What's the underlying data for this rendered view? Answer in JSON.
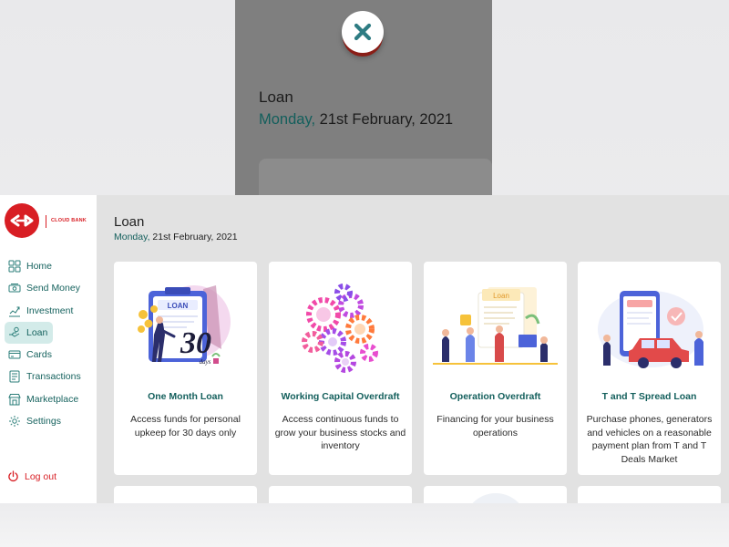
{
  "overlay": {
    "title": "Loan",
    "date_day": "Monday,",
    "date_rest": " 21st February, 2021"
  },
  "brand": {
    "name": "CLOUD BANK",
    "accent": "#d81e24",
    "teal": "#135f5c"
  },
  "sidebar": {
    "items": [
      {
        "label": "Home",
        "icon": "home-grid-icon"
      },
      {
        "label": "Send Money",
        "icon": "money-icon"
      },
      {
        "label": "Investment",
        "icon": "chart-icon"
      },
      {
        "label": "Loan",
        "icon": "loan-icon",
        "active": true
      },
      {
        "label": "Cards",
        "icon": "card-icon"
      },
      {
        "label": "Transactions",
        "icon": "transactions-icon"
      },
      {
        "label": "Marketplace",
        "icon": "store-icon"
      },
      {
        "label": "Settings",
        "icon": "gear-icon"
      }
    ],
    "logout": "Log out"
  },
  "page": {
    "title": "Loan",
    "date_day": "Monday,",
    "date_rest": " 21st February, 2021"
  },
  "cards": [
    {
      "title": "One Month Loan",
      "description": "Access funds for personal upkeep for 30 days only",
      "illustration": "clipboard-30-days-illustration"
    },
    {
      "title": "Working Capital Overdraft",
      "description": "Access continuous funds to grow your business stocks and inventory",
      "illustration": "gears-illustration"
    },
    {
      "title": "Operation Overdraft",
      "description": "Financing for your business operations",
      "illustration": "team-office-illustration"
    },
    {
      "title": "T and T Spread Loan",
      "description": "Purchase phones, generators and vehicles on a reasonable payment plan from T and T Deals Market",
      "illustration": "phone-car-illustration"
    }
  ],
  "illus_text": {
    "clip_header": "LOAN",
    "clip_number": "30",
    "clip_days": "days",
    "doc_header": "Loan"
  }
}
